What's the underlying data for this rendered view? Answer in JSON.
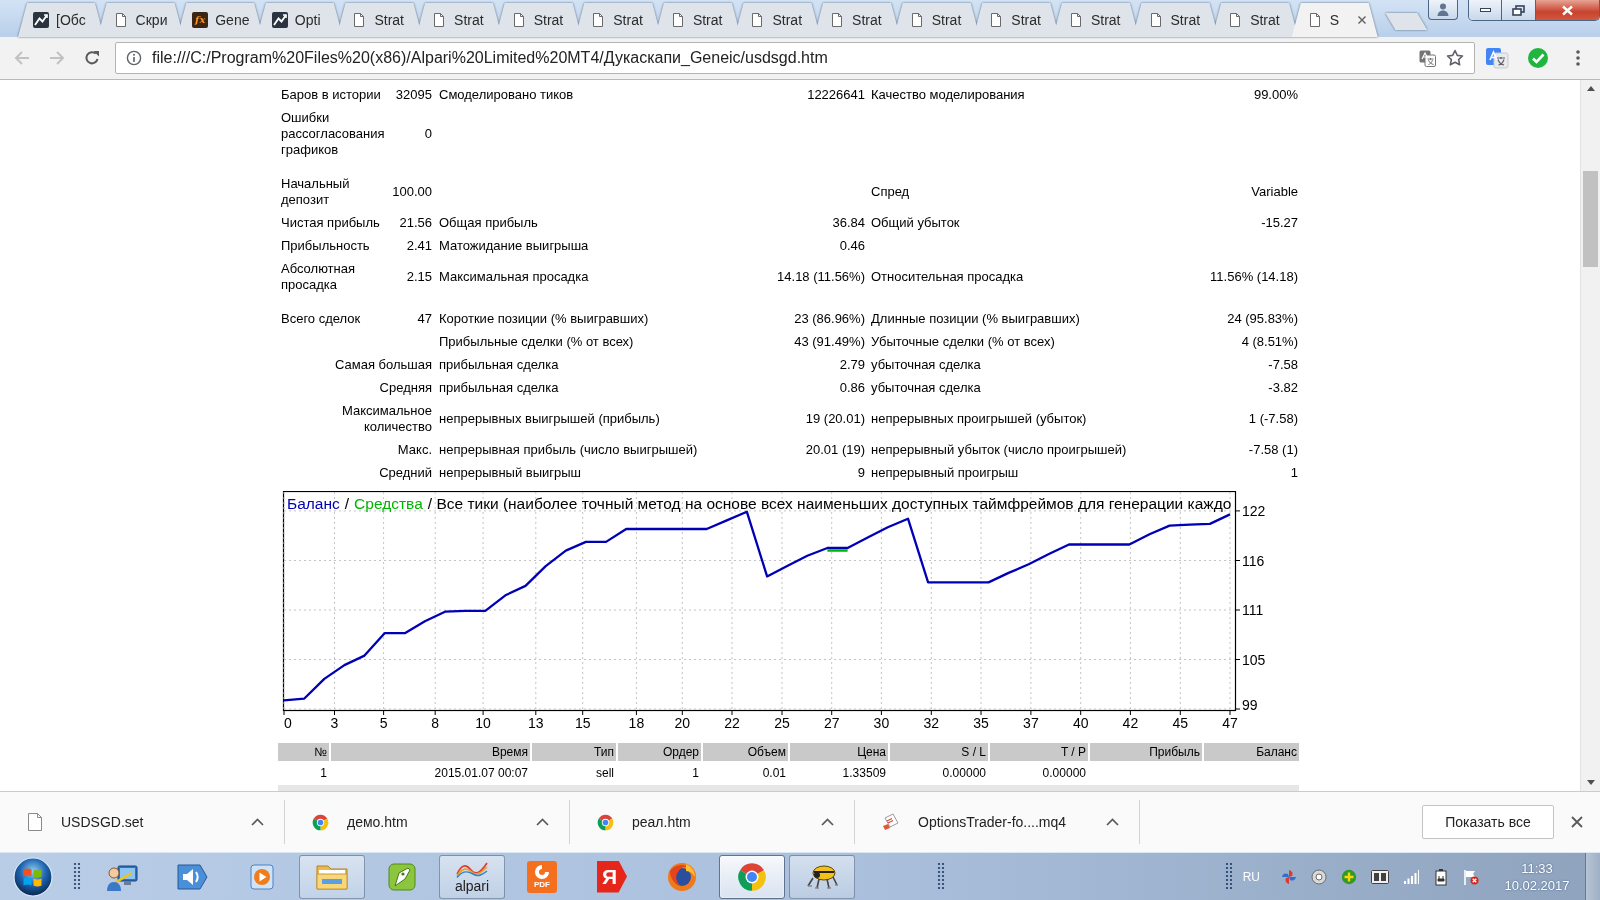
{
  "tabs": [
    {
      "kind": "mt4",
      "title": "[Обс",
      "selected": false
    },
    {
      "kind": "doc",
      "title": "Скри",
      "selected": false
    },
    {
      "kind": "fx",
      "icon_text": "fx",
      "title": "Gene",
      "selected": false
    },
    {
      "kind": "mt4",
      "title": "Opti",
      "selected": false
    },
    {
      "kind": "doc",
      "title": "Strat",
      "selected": false
    },
    {
      "kind": "doc",
      "title": "Strat",
      "selected": false
    },
    {
      "kind": "doc",
      "title": "Strat",
      "selected": false
    },
    {
      "kind": "doc",
      "title": "Strat",
      "selected": false
    },
    {
      "kind": "doc",
      "title": "Strat",
      "selected": false
    },
    {
      "kind": "doc",
      "title": "Strat",
      "selected": false
    },
    {
      "kind": "doc",
      "title": "Strat",
      "selected": false
    },
    {
      "kind": "doc",
      "title": "Strat",
      "selected": false
    },
    {
      "kind": "doc",
      "title": "Strat",
      "selected": false
    },
    {
      "kind": "doc",
      "title": "Strat",
      "selected": false
    },
    {
      "kind": "doc",
      "title": "Strat",
      "selected": false
    },
    {
      "kind": "doc",
      "title": "Strat",
      "selected": false
    },
    {
      "kind": "doc",
      "title": "S",
      "selected": true
    }
  ],
  "toolbar": {
    "nav_buttons": [
      {
        "kind": "back",
        "disabled": true
      },
      {
        "kind": "forward",
        "disabled": true
      },
      {
        "kind": "reload",
        "disabled": false
      }
    ],
    "url": "file:///C:/Program%20Files%20(x86)/Alpari%20Limited%20MT4/Дукаскапи_Geneic/usdsgd.htm"
  },
  "report": {
    "sections": [
      {
        "rows": [
          {
            "kind": "stat",
            "left": {
              "label": "Баров в истории",
              "value": "32095"
            },
            "middle": {
              "label": "Смоделировано тиков",
              "value": "12226641"
            },
            "right": {
              "label": "Качество моделирования",
              "value": "99.00%"
            }
          },
          {
            "kind": "stat",
            "left": {
              "label": "Ошибки рассогласования графиков",
              "value": "0"
            }
          }
        ]
      },
      {
        "rows": [
          {
            "kind": "stat",
            "left": {
              "label": "Начальный депозит",
              "value": "100.00"
            },
            "right": {
              "label": "Спред",
              "value": "Variable"
            }
          },
          {
            "kind": "stat",
            "left": {
              "label": "Чистая прибыль",
              "value": "21.56"
            },
            "middle": {
              "label": "Общая прибыль",
              "value": "36.84"
            },
            "right": {
              "label": "Общий убыток",
              "value": "-15.27"
            }
          },
          {
            "kind": "stat",
            "left": {
              "label": "Прибыльность",
              "value": "2.41"
            },
            "middle": {
              "label": "Матожидание выигрыша",
              "value": "0.46"
            }
          },
          {
            "kind": "stat",
            "left": {
              "label": "Абсолютная просадка",
              "value": "2.15"
            },
            "middle": {
              "label": "Максимальная просадка",
              "value": "14.18 (11.56%)"
            },
            "right": {
              "label": "Относительная просадка",
              "value": "11.56% (14.18)"
            }
          }
        ]
      },
      {
        "rows": [
          {
            "kind": "stat",
            "left": {
              "label": "Всего сделок",
              "value": "47"
            },
            "middle": {
              "label": "Короткие позиции (% выигравших)",
              "value": "23 (86.96%)"
            },
            "right": {
              "label": "Длинные позиции (% выигравших)",
              "value": "24 (95.83%)"
            }
          },
          {
            "kind": "stat",
            "middle": {
              "label": "Прибыльные сделки (% от всех)",
              "value": "43 (91.49%)"
            },
            "right": {
              "label": "Убыточные сделки (% от всех)",
              "value": "4 (8.51%)"
            }
          },
          {
            "kind": "group",
            "group": "Самая большая",
            "middle": {
              "label": "прибыльная сделка",
              "value": "2.79"
            },
            "right": {
              "label": "убыточная сделка",
              "value": "-7.58"
            }
          },
          {
            "kind": "group",
            "group": "Средняя",
            "middle": {
              "label": "прибыльная сделка",
              "value": "0.86"
            },
            "right": {
              "label": "убыточная сделка",
              "value": "-3.82"
            }
          },
          {
            "kind": "group",
            "group": "Максимальное количество",
            "middle": {
              "label": "непрерывных выигрышей (прибыль)",
              "value": "19 (20.01)"
            },
            "right": {
              "label": "непрерывных проигрышей (убыток)",
              "value": "1 (-7.58)"
            }
          },
          {
            "kind": "group",
            "group": "Макс.",
            "middle": {
              "label": "непрерывная прибыль (число выигрышей)",
              "value": "20.01 (19)"
            },
            "right": {
              "label": "непрерывный убыток (число проигрышей)",
              "value": "-7.58 (1)"
            }
          },
          {
            "kind": "group",
            "group": "Средний",
            "middle": {
              "label": "непрерывный выигрыш",
              "value": "9"
            },
            "right": {
              "label": "непрерывный проигрыш",
              "value": "1"
            }
          }
        ]
      }
    ]
  },
  "chart": {
    "chart_data": {
      "type": "line",
      "title": "/ Все тики (наиболее точный метод на основе всех наименьших доступных таймфреймов для генерации каждо",
      "annotations": [
        "/"
      ],
      "x": [
        0,
        1,
        2,
        3,
        4,
        5,
        6,
        7,
        8,
        9,
        10,
        11,
        12,
        13,
        14,
        15,
        16,
        17,
        18,
        19,
        20,
        21,
        22,
        23,
        24,
        25,
        26,
        27,
        28,
        29,
        30,
        31,
        32,
        33,
        34,
        35,
        36,
        37,
        38,
        39,
        40,
        41,
        42,
        43,
        44,
        45,
        46,
        47
      ],
      "xlim": [
        0,
        47
      ],
      "ylim": [
        99,
        124.2
      ],
      "xticks": [
        {
          "value": 0,
          "label": "0"
        },
        {
          "value": 2.51,
          "label": "3"
        },
        {
          "value": 4.95,
          "label": "5"
        },
        {
          "value": 7.51,
          "label": "8"
        },
        {
          "value": 9.89,
          "label": "10"
        },
        {
          "value": 12.51,
          "label": "13"
        },
        {
          "value": 14.84,
          "label": "15"
        },
        {
          "value": 17.51,
          "label": "18"
        },
        {
          "value": 19.79,
          "label": "20"
        },
        {
          "value": 22.26,
          "label": "22"
        },
        {
          "value": 24.74,
          "label": "25"
        },
        {
          "value": 27.21,
          "label": "27"
        },
        {
          "value": 29.68,
          "label": "30"
        },
        {
          "value": 32.16,
          "label": "32"
        },
        {
          "value": 34.63,
          "label": "35"
        },
        {
          "value": 37.11,
          "label": "37"
        },
        {
          "value": 39.58,
          "label": "40"
        },
        {
          "value": 42.05,
          "label": "42"
        },
        {
          "value": 44.53,
          "label": "45"
        },
        {
          "value": 47,
          "label": "47"
        }
      ],
      "yticks": [
        {
          "value": 99,
          "label": "99"
        },
        {
          "value": 104.75,
          "label": "105"
        },
        {
          "value": 110.5,
          "label": "111"
        },
        {
          "value": 116.25,
          "label": "116"
        },
        {
          "value": 122,
          "label": "122"
        }
      ],
      "grid": true,
      "series": [
        {
          "name": "Баланс",
          "color": "#0000b4",
          "values": [
            100,
            100.2,
            102.5,
            104.1,
            105.2,
            107.8,
            107.8,
            109.2,
            110.3,
            110.4,
            110.4,
            112.2,
            113.3,
            115.6,
            117.4,
            118.4,
            118.4,
            119.9,
            119.9,
            119.9,
            119.9,
            119.9,
            120.9,
            121.9,
            114.4,
            115.6,
            116.8,
            117.7,
            117.7,
            118.9,
            120.1,
            121.1,
            113.7,
            113.7,
            113.7,
            113.7,
            114.8,
            115.8,
            117,
            118.1,
            118.1,
            118.1,
            118.1,
            119.3,
            120.3,
            120.4,
            120.5,
            121.6
          ]
        },
        {
          "name": "Средства",
          "color": "#00b400",
          "values": [
            null,
            null,
            null,
            null,
            null,
            null,
            null,
            null,
            null,
            null,
            null,
            null,
            null,
            null,
            null,
            null,
            null,
            null,
            null,
            null,
            null,
            null,
            null,
            null,
            null,
            null,
            null,
            117.4,
            117.4,
            null,
            null,
            null,
            null,
            null,
            null,
            null,
            null,
            null,
            null,
            null,
            null,
            null,
            null,
            null,
            null,
            null,
            null,
            null
          ]
        }
      ]
    }
  },
  "trades": {
    "columns": [
      "№",
      "Время",
      "Тип",
      "Ордер",
      "Объем",
      "Цена",
      "S / L",
      "T / P",
      "Прибыль",
      "Баланс"
    ],
    "rows": [
      {
        "cells": [
          "1",
          "2015.01.07 00:07",
          "sell",
          "1",
          "0.01",
          "1.33509",
          "0.00000",
          "0.00000"
        ]
      }
    ]
  },
  "downloads": {
    "items": [
      {
        "kind": "file",
        "name": "USDSGD.set"
      },
      {
        "kind": "chrome",
        "name": "демо.htm"
      },
      {
        "kind": "chrome",
        "name": "реал.htm"
      },
      {
        "kind": "script",
        "name": "OptionsTrader-fo....mq4"
      }
    ],
    "show_all": "Показать все"
  },
  "taskbar": {
    "apps": [
      {
        "kind": "pen",
        "open": false,
        "selected": false
      },
      {
        "kind": "speaker",
        "open": false,
        "selected": false
      },
      {
        "kind": "media",
        "open": false,
        "selected": false
      },
      {
        "kind": "folder",
        "open": true,
        "selected": false
      },
      {
        "kind": "leaf",
        "open": false,
        "selected": false
      },
      {
        "kind": "alpari",
        "label": "alpari",
        "open": true,
        "selected": false
      },
      {
        "kind": "pdf",
        "label": "PDF",
        "open": false,
        "selected": false
      },
      {
        "kind": "yandex",
        "label": "Я",
        "open": false,
        "selected": false
      },
      {
        "kind": "firefox",
        "open": false,
        "selected": false
      },
      {
        "kind": "chrome",
        "open": true,
        "selected": true
      },
      {
        "kind": "beetle",
        "open": true,
        "selected": false
      }
    ],
    "language": "RU",
    "time": "11:33",
    "date": "10.02.2017"
  }
}
